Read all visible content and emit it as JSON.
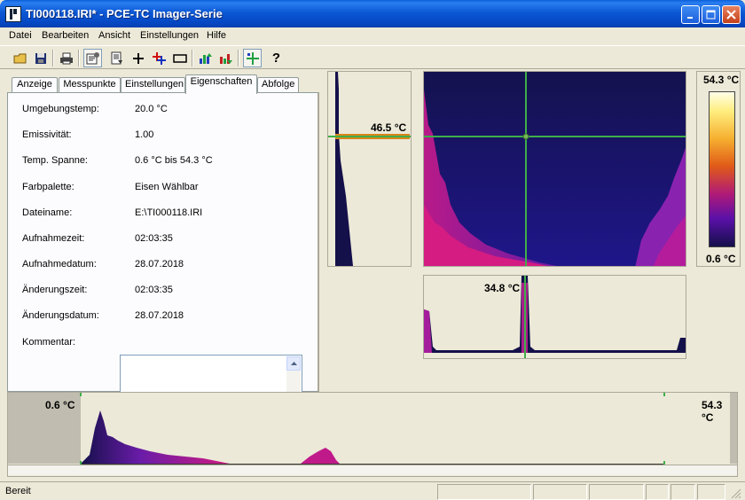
{
  "window": {
    "title": "TI000118.IRI* - PCE-TC Imager-Serie"
  },
  "menu": [
    "Datei",
    "Bearbeiten",
    "Ansicht",
    "Einstellungen",
    "Hilfe"
  ],
  "toolbar": {
    "buttons": [
      "open-icon",
      "save-icon",
      "print-icon",
      "properties-icon",
      "report-icon",
      "crosshair-icon",
      "multi-point-icon",
      "rectangle-icon",
      "palette-up-icon",
      "palette-down-icon",
      "cursor-line-icon",
      "help-icon"
    ],
    "help_label": "?"
  },
  "tabs": [
    "Anzeige",
    "Messpunkte",
    "Einstellungen",
    "Eigenschaften",
    "Abfolge"
  ],
  "active_tab": "Eigenschaften",
  "properties": [
    {
      "label": "Umgebungstemp:",
      "value": "20.0 °C"
    },
    {
      "label": "Emissivität:",
      "value": "1.00"
    },
    {
      "label": "Temp. Spanne:",
      "value": "0.6 °C bis 54.3 °C"
    },
    {
      "label": "Farbpalette:",
      "value": "Eisen Wählbar"
    },
    {
      "label": "Dateiname:",
      "value": "E:\\TI000118.IRI"
    },
    {
      "label": "Aufnahmezeit:",
      "value": "02:03:35"
    },
    {
      "label": "Aufnahmedatum:",
      "value": "28.07.2018"
    },
    {
      "label": "Änderungszeit:",
      "value": "02:03:35"
    },
    {
      "label": "Änderungsdatum:",
      "value": "28.07.2018"
    }
  ],
  "comment": {
    "label": "Kommentar:",
    "value": ""
  },
  "profiles": {
    "vertical_temp": "46.5 °C",
    "horizontal_temp": "34.8 °C"
  },
  "colorbar": {
    "max": "54.3 °C",
    "min": "0.6 °C"
  },
  "histogram": {
    "min_label": "0.6 °C",
    "max_label": "54.3 °C"
  },
  "status": {
    "text": "Bereit"
  },
  "colors": {
    "titlebar": "#0b58d5",
    "cursor_line": "#3fae49",
    "palette_low": "#1a0f5a",
    "palette_high": "#d01a80"
  }
}
